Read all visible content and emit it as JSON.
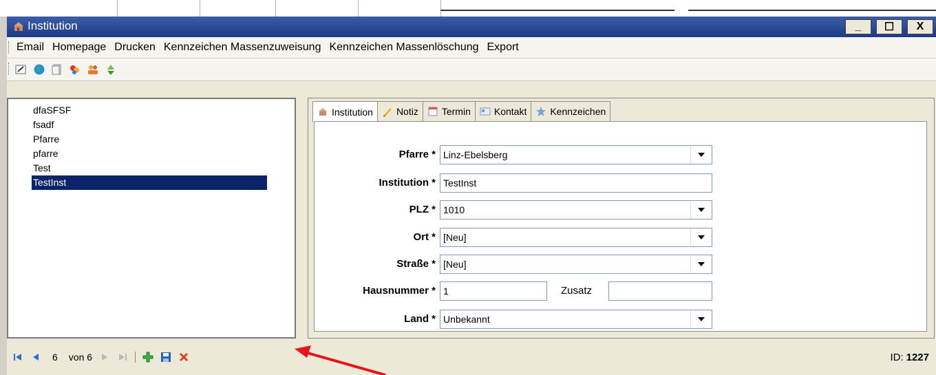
{
  "window": {
    "title": "Institution",
    "minimize_label": "_",
    "maximize_label": "☐",
    "close_label": "X"
  },
  "menu": {
    "items": [
      "Email",
      "Homepage",
      "Drucken",
      "Kennzeichen Massenzuweisung",
      "Kennzeichen Massenlöschung",
      "Export"
    ]
  },
  "toolbar": {
    "icons": [
      "edit-icon",
      "globe-icon",
      "document-icon",
      "contacts-icon",
      "users-icon",
      "recycle-icon"
    ]
  },
  "list": {
    "items": [
      "dfaSFSF",
      "fsadf",
      "Pfarre",
      "pfarre",
      "Test",
      "TestInst"
    ],
    "selected_index": 5
  },
  "tabs": [
    {
      "label": "Institution",
      "icon": "institution-icon"
    },
    {
      "label": "Notiz",
      "icon": "note-icon"
    },
    {
      "label": "Termin",
      "icon": "calendar-icon"
    },
    {
      "label": "Kontakt",
      "icon": "contact-card-icon"
    },
    {
      "label": "Kennzeichen",
      "icon": "star-icon"
    }
  ],
  "form": {
    "pfarre": {
      "label": "Pfarre *",
      "value": "Linz-Ebelsberg"
    },
    "institution": {
      "label": "Institution *",
      "value": "TestInst"
    },
    "plz": {
      "label": "PLZ *",
      "value": "1010"
    },
    "ort": {
      "label": "Ort *",
      "value": "[Neu]"
    },
    "strasse": {
      "label": "Straße *",
      "value": "[Neu]"
    },
    "hausnummer": {
      "label": "Hausnummer *",
      "value": "1"
    },
    "zusatz": {
      "label": "Zusatz",
      "value": ""
    },
    "land": {
      "label": "Land *",
      "value": "Unbekannt"
    }
  },
  "status": {
    "current": "6",
    "of_label": "von 6",
    "id_label": "ID:",
    "id_value": "1227"
  },
  "colors": {
    "title_bar": "#1d3a85",
    "selection": "#0a246a",
    "arrow": "#e8141c"
  }
}
